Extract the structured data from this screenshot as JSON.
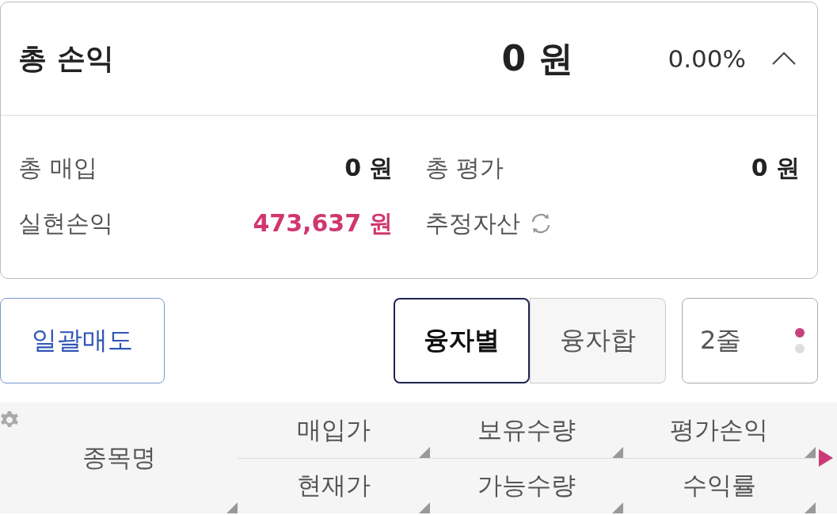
{
  "summary": {
    "title": "총 손익",
    "amount": "0 원",
    "rate": "0.00%",
    "expanded": true,
    "details": [
      {
        "kind": "value",
        "label": "총 매입",
        "value": "0 원",
        "highlight": false
      },
      {
        "kind": "value",
        "label": "총 평가",
        "value": "0 원",
        "highlight": false
      },
      {
        "kind": "value",
        "label": "실현손익",
        "value": "473,637 원",
        "highlight": true
      },
      {
        "kind": "refresh",
        "label": "추정자산"
      }
    ]
  },
  "actions": {
    "sell_all": "일괄매도",
    "toggle": [
      {
        "label": "융자별",
        "selected": true
      },
      {
        "label": "융자합",
        "selected": false
      }
    ],
    "line_mode": {
      "label": "2줄",
      "pages": [
        {
          "selected": true
        },
        {
          "selected": false
        }
      ]
    }
  },
  "table": {
    "first_column": "종목명",
    "columns": [
      {
        "top": "매입가",
        "bottom": "현재가"
      },
      {
        "top": "보유수량",
        "bottom": "가능수량"
      },
      {
        "top": "평가손익",
        "bottom": "수익률"
      }
    ]
  }
}
